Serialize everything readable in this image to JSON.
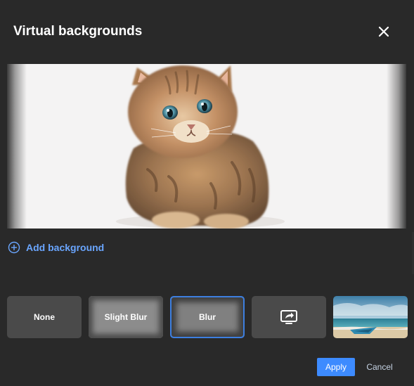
{
  "dialog": {
    "title": "Virtual backgrounds",
    "close_icon": "close-icon"
  },
  "preview": {
    "subject": "kitten-image"
  },
  "add_background": {
    "icon": "plus-circle-icon",
    "label": "Add background"
  },
  "options": [
    {
      "label": "None"
    },
    {
      "label": "Slight Blur"
    },
    {
      "label": "Blur"
    },
    {
      "icon": "screen-share-icon"
    },
    {
      "icon": "beach-thumbnail"
    }
  ],
  "selected_option": "Blur",
  "footer": {
    "apply_label": "Apply",
    "cancel_label": "Cancel"
  },
  "colors": {
    "background": "#292929",
    "accent": "#3d8bff",
    "link": "#6aa6ff",
    "selected_border": "#3d7fe0"
  }
}
